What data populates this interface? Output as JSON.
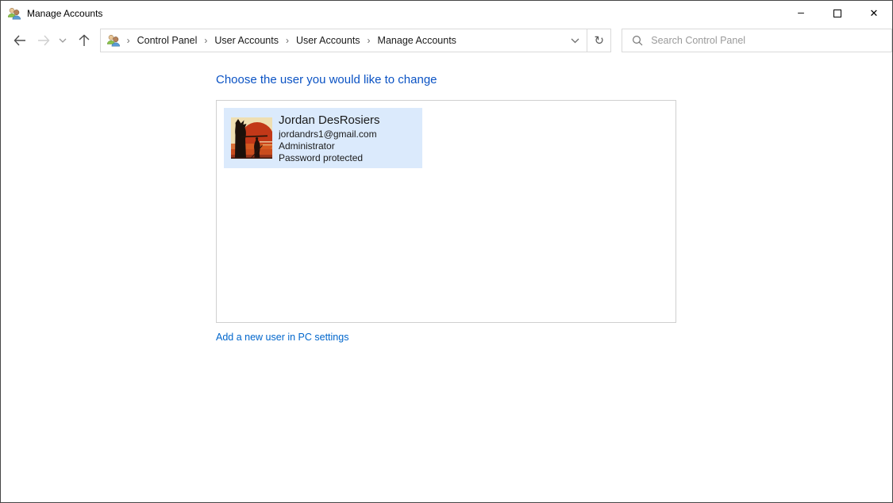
{
  "window": {
    "title": "Manage Accounts",
    "controls": {
      "minimize_glyph": "–",
      "close_glyph": "✕"
    }
  },
  "navbar": {
    "breadcrumb": {
      "separator": "›",
      "items": [
        "Control Panel",
        "User Accounts",
        "User Accounts",
        "Manage Accounts"
      ]
    },
    "search": {
      "placeholder": "Search Control Panel"
    }
  },
  "main": {
    "heading": "Choose the user you would like to change",
    "users": [
      {
        "name": "Jordan DesRosiers",
        "email": "jordandrs1@gmail.com",
        "role": "Administrator",
        "password_status": "Password protected"
      }
    ],
    "add_user_link": "Add a new user in PC settings"
  },
  "colors": {
    "heading_blue": "#0b53c4",
    "link_blue": "#0066cc",
    "selected_tile_bg": "#dbeafc",
    "listbox_border": "#d0d0d0",
    "window_border": "#464646"
  }
}
